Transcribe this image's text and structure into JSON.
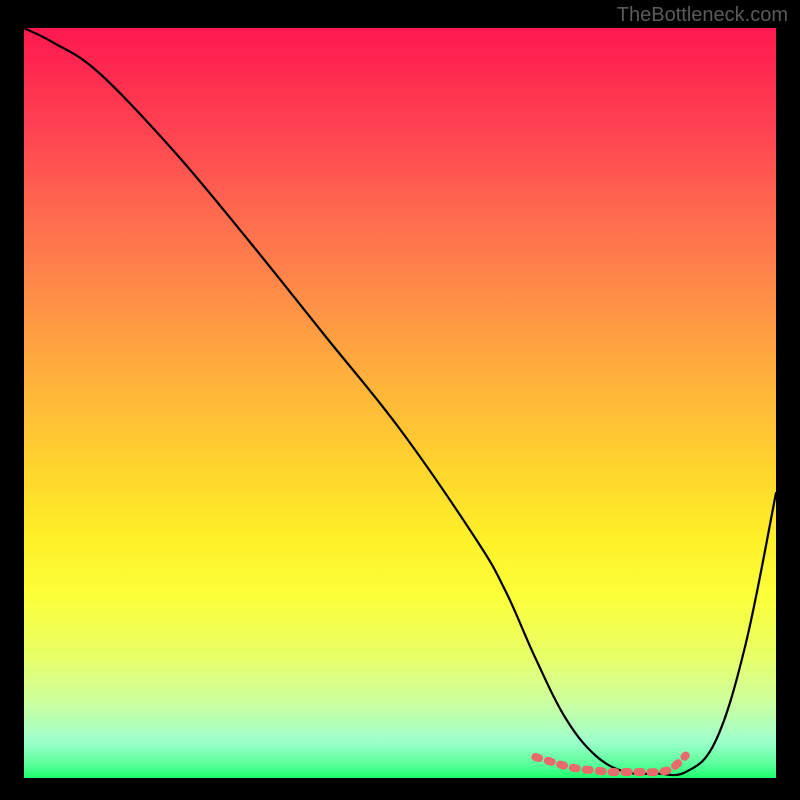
{
  "watermark": "TheBottleneck.com",
  "chart_data": {
    "type": "line",
    "title": "",
    "xlabel": "",
    "ylabel": "",
    "xlim": [
      0,
      100
    ],
    "ylim": [
      0,
      100
    ],
    "series": [
      {
        "name": "bottleneck-curve",
        "x": [
          0,
          4,
          10,
          20,
          30,
          40,
          50,
          60,
          64,
          68,
          72,
          76,
          80,
          84,
          88,
          92,
          96,
          100
        ],
        "y": [
          100,
          98,
          94,
          83.5,
          71.5,
          59,
          46.5,
          32,
          25,
          16,
          8,
          3,
          0.8,
          0.6,
          0.8,
          5,
          18,
          38
        ]
      },
      {
        "name": "optimal-range-marker",
        "x": [
          68,
          70,
          72,
          74,
          76,
          78,
          80,
          82,
          84,
          86,
          88
        ],
        "y": [
          2.8,
          2.2,
          1.6,
          1.2,
          1.0,
          0.8,
          0.8,
          0.8,
          0.8,
          1.2,
          3.0
        ]
      }
    ],
    "colors": {
      "curve": "#000000",
      "marker": "#e96a6a"
    }
  }
}
